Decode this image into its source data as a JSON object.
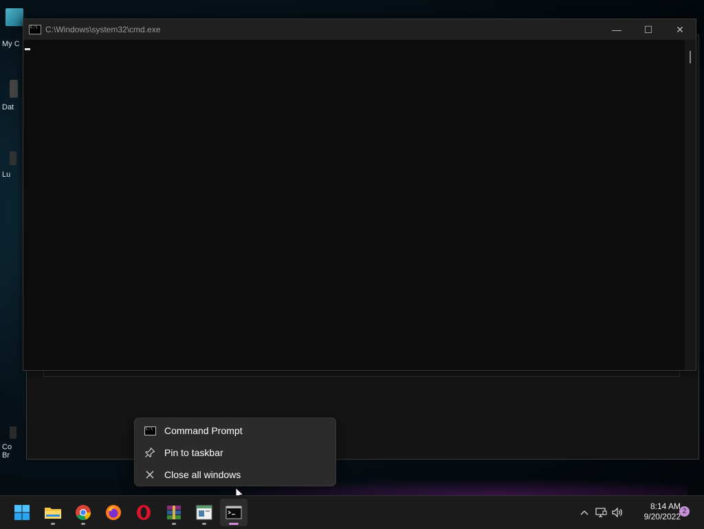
{
  "desktop": {
    "icons": [
      {
        "label": "My C"
      },
      {
        "label": "Dat"
      },
      {
        "label": "Lu"
      },
      {
        "label": "Co\nBr"
      }
    ]
  },
  "cmd_window": {
    "title": "C:\\Windows\\system32\\cmd.exe",
    "minimize": "—",
    "maximize": "☐",
    "close": "✕"
  },
  "context_menu": {
    "items": [
      {
        "label": "Command Prompt",
        "icon": "cmd-icon"
      },
      {
        "label": "Pin to taskbar",
        "icon": "pin-icon"
      },
      {
        "label": "Close all windows",
        "icon": "close-icon"
      }
    ]
  },
  "taskbar": {
    "apps": [
      "start",
      "file-explorer",
      "chrome",
      "firefox",
      "opera",
      "winrar",
      "notepad-like",
      "command-prompt"
    ],
    "tray": {
      "time": "8:14 AM",
      "date": "9/20/2022",
      "notification_count": "2"
    }
  },
  "colors": {
    "accent_active": "#d78ad6",
    "menu_bg": "#2b2b2b",
    "taskbar_bg": "#1b1b1b"
  }
}
